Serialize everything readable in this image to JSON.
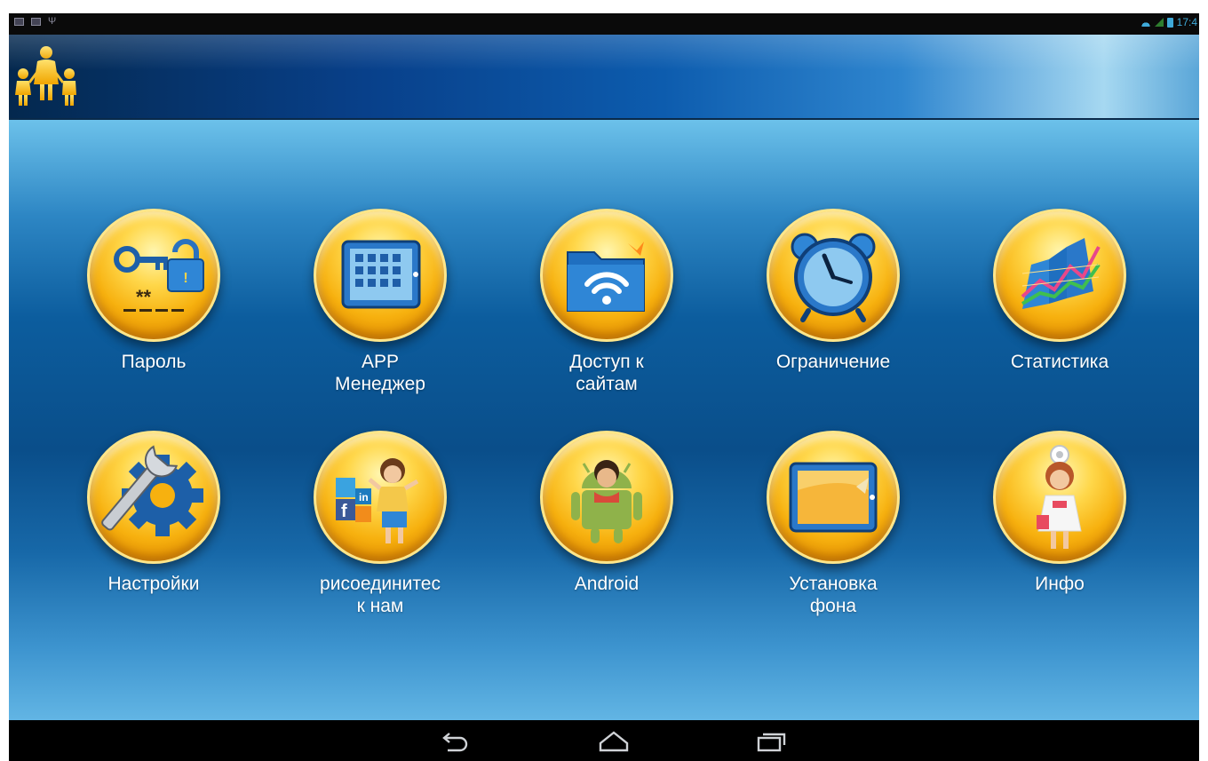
{
  "status_bar": {
    "time": "17:4",
    "left_icons": [
      "picture-icon",
      "mail-icon",
      "usb-icon"
    ],
    "right_icons": [
      "wifi-icon",
      "signal-icon",
      "battery-icon"
    ]
  },
  "header": {
    "logo_icon": "family-icon"
  },
  "menu": {
    "row1": [
      {
        "label": "Пароль",
        "icon": "password-key-lock-icon"
      },
      {
        "label": "APP\nМенеджер",
        "icon": "app-manager-tablet-icon"
      },
      {
        "label": "Доступ к\nсайтам",
        "icon": "wifi-folder-icon"
      },
      {
        "label": "Ограничение",
        "icon": "alarm-clock-icon"
      },
      {
        "label": "Статистика",
        "icon": "statistics-chart-icon"
      }
    ],
    "row2": [
      {
        "label": "Настройки",
        "icon": "settings-wrench-gear-icon"
      },
      {
        "label": "рисоединитес\nк нам",
        "icon": "social-girl-icon"
      },
      {
        "label": "Android",
        "icon": "android-boy-icon"
      },
      {
        "label": "Установка\nфона",
        "icon": "wallpaper-tablet-icon"
      },
      {
        "label": "Инфо",
        "icon": "info-doctor-girl-icon"
      }
    ]
  },
  "nav_bar": {
    "buttons": [
      "back-icon",
      "home-icon",
      "recent-apps-icon"
    ]
  },
  "colors": {
    "accent_gold": "#f7b10f",
    "header_dark": "#04284e",
    "background_blue": "#0a4e8a",
    "label_text": "#ffffff"
  }
}
